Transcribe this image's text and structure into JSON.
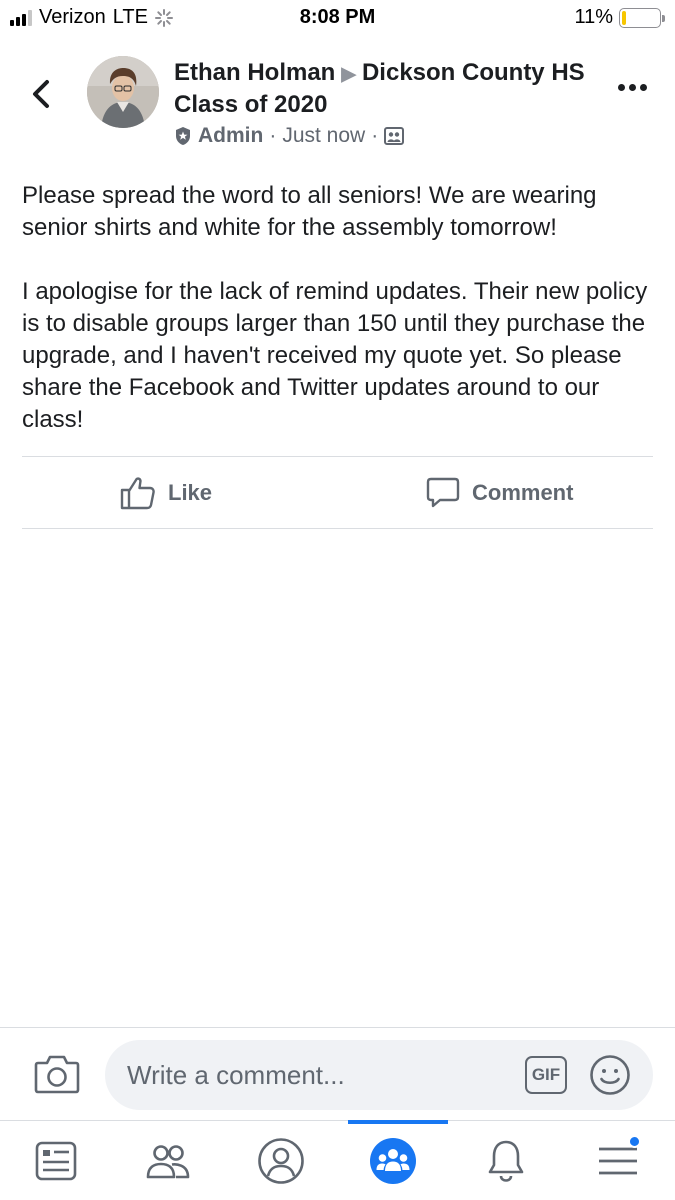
{
  "status_bar": {
    "carrier": "Verizon",
    "network": "LTE",
    "time": "8:08 PM",
    "battery_percent": "11%",
    "battery_level": 0.11
  },
  "post": {
    "author": "Ethan Holman",
    "group": "Dickson County HS Class of 2020",
    "role": "Admin",
    "separator": "·",
    "timestamp": "Just now",
    "paragraphs": [
      "Please spread the word to all seniors! We are wearing senior shirts and white for the assembly tomorrow!",
      "I apologise for the lack of remind updates. Their new policy is to disable groups larger than 150 until they purchase the upgrade, and I haven't received my quote yet. So please share the Facebook and Twitter updates around to our class!"
    ]
  },
  "actions": {
    "like_label": "Like",
    "comment_label": "Comment"
  },
  "composer": {
    "placeholder": "Write a comment...",
    "gif_label": "GIF"
  },
  "tab_bar": {
    "tabs": [
      "news-feed",
      "friends",
      "profile",
      "groups",
      "notifications",
      "menu"
    ],
    "active": "groups"
  },
  "colors": {
    "accent": "#1877f2",
    "text": "#1c1e21",
    "secondary_text": "#606770",
    "battery": "#f7c600"
  }
}
